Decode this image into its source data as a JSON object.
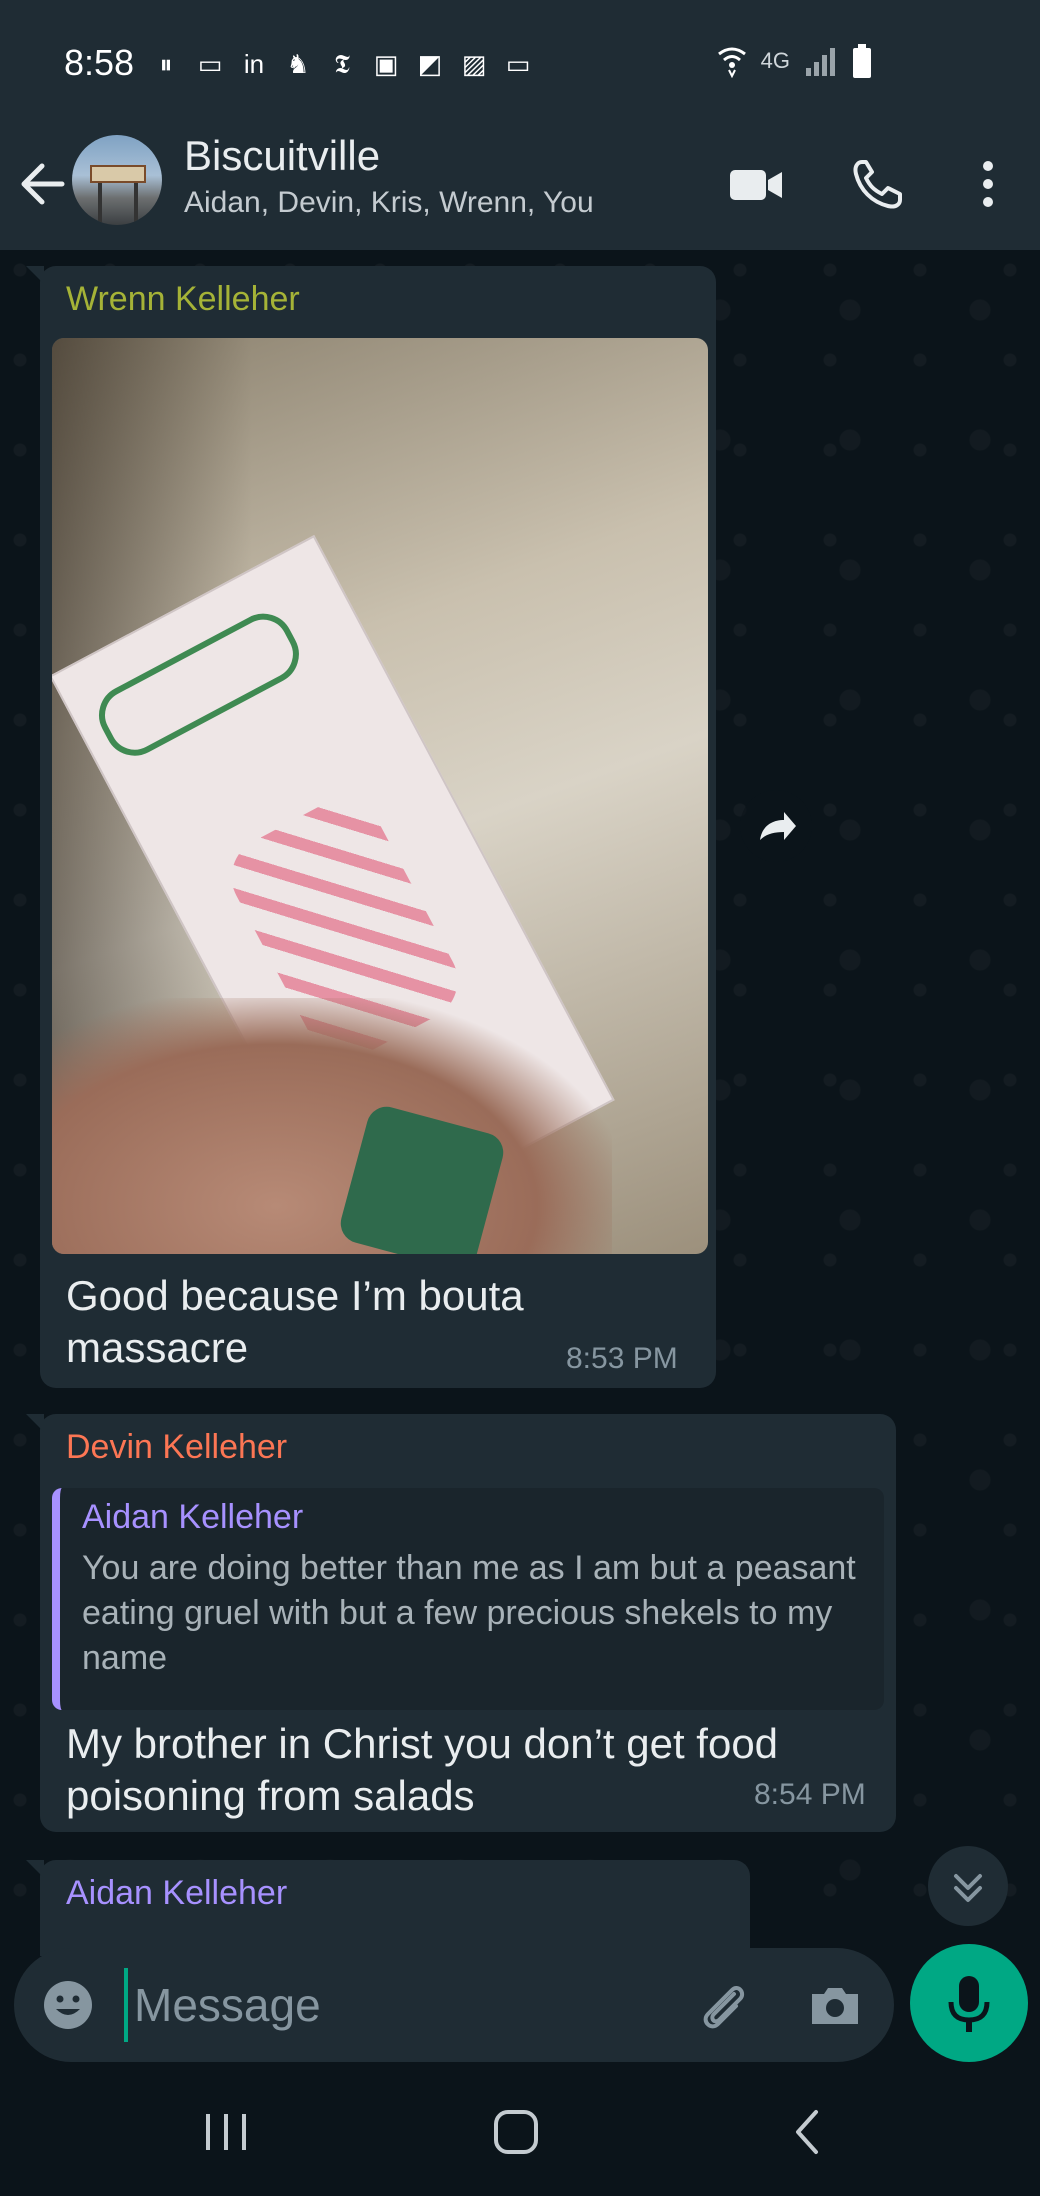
{
  "status_bar": {
    "time": "8:58",
    "network": "4G",
    "app_icons": [
      "pause-icon",
      "cast-icon",
      "linkedin-icon",
      "robinhood-icon",
      "nytimes-icon",
      "app-icon",
      "app-icon-2",
      "gallery-icon",
      "laptop-icon"
    ]
  },
  "header": {
    "title": "Biscuitville",
    "subtitle": "Aidan, Devin, Kris, Wrenn, You"
  },
  "messages": [
    {
      "sender": "Wrenn Kelleher",
      "text": "Good because I’m bouta massacre",
      "time": "8:53 PM",
      "has_image": true
    },
    {
      "sender": "Devin Kelleher",
      "quote": {
        "sender": "Aidan Kelleher",
        "text": "You are doing better than me as I am but a peasant eating gruel with but a few precious shekels to my name"
      },
      "text": "My brother in Christ you don’t get food poisoning from salads",
      "time": "8:54 PM"
    },
    {
      "sender": "Aidan Kelleher"
    }
  ],
  "input": {
    "placeholder": "Message"
  },
  "colors": {
    "accent": "#00a884",
    "bubble": "#1f2c34",
    "wrenn": "#a5b337",
    "devin": "#fc7654",
    "aidan": "#a791ff"
  }
}
